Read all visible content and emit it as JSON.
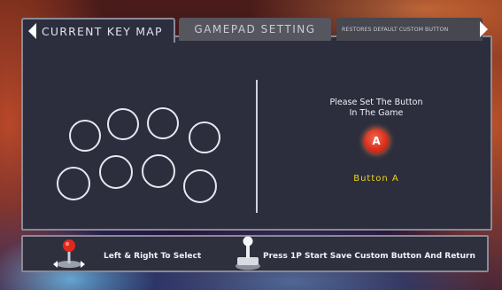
{
  "tabs": {
    "current_key_map": "CURRENT KEY MAP",
    "gamepad_setting": "GAMEPAD SETTING",
    "restore_default": "RESTORES DEFAULT CUSTOM BUTTON"
  },
  "main": {
    "prompt_line1": "Please Set The Button",
    "prompt_line2": "In The Game",
    "active_button_glyph": "A",
    "active_button_label": "Button A"
  },
  "footer": {
    "select_hint": "Left & Right To Select",
    "save_hint": "Press 1P Start Save Custom Button And Return"
  },
  "colors": {
    "panel_bg": "#2c2e3e",
    "accent_label": "#f2d21a",
    "button_red": "#d8301d"
  },
  "icons": {
    "tab_left": "arrow-left-icon",
    "tab_right": "arrow-right-icon",
    "joystick_red": "joystick-icon",
    "joystick_white": "stick-icon"
  }
}
